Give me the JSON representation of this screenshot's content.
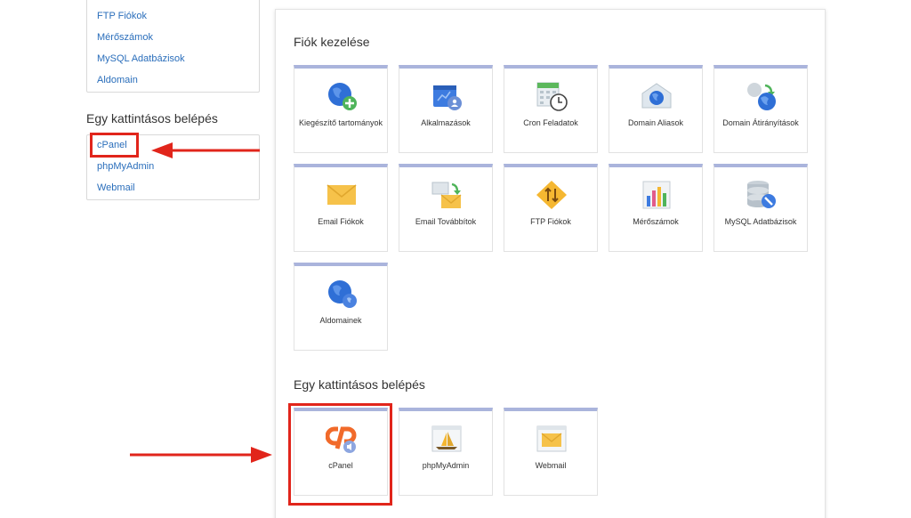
{
  "sidebar": {
    "links_top": [
      {
        "label": "FTP Fiókok"
      },
      {
        "label": "Mérőszámok"
      },
      {
        "label": "MySQL Adatbázisok"
      },
      {
        "label": "Aldomain"
      }
    ],
    "login_heading": "Egy kattintásos belépés",
    "login_links": [
      {
        "label": "cPanel"
      },
      {
        "label": "phpMyAdmin"
      },
      {
        "label": "Webmail"
      }
    ]
  },
  "main": {
    "account_title": "Fiók kezelése",
    "account_tiles": [
      {
        "label": "Kiegészítő tartományok",
        "icon": "globe-plus-icon"
      },
      {
        "label": "Alkalmazások",
        "icon": "applications-icon"
      },
      {
        "label": "Cron Feladatok",
        "icon": "calendar-clock-icon"
      },
      {
        "label": "Domain Aliasok",
        "icon": "domain-alias-icon"
      },
      {
        "label": "Domain Átirányítások",
        "icon": "domain-redirect-icon"
      },
      {
        "label": "Email Fiókok",
        "icon": "envelope-icon"
      },
      {
        "label": "Email Továbbítok",
        "icon": "email-forward-icon"
      },
      {
        "label": "FTP Fiókok",
        "icon": "ftp-icon"
      },
      {
        "label": "Mérőszámok",
        "icon": "metrics-icon"
      },
      {
        "label": "MySQL Adatbázisok",
        "icon": "database-icon"
      },
      {
        "label": "Aldomainek",
        "icon": "subdomain-globe-icon"
      }
    ],
    "login_title": "Egy kattintásos belépés",
    "login_tiles": [
      {
        "label": "cPanel",
        "icon": "cpanel-icon"
      },
      {
        "label": "phpMyAdmin",
        "icon": "phpmyadmin-icon"
      },
      {
        "label": "Webmail",
        "icon": "webmail-icon"
      }
    ]
  },
  "colors": {
    "link": "#2a6ebb",
    "tile_top_border": "#aab4dc",
    "highlight": "#e1251b",
    "cpanel_orange": "#f16a2a"
  }
}
